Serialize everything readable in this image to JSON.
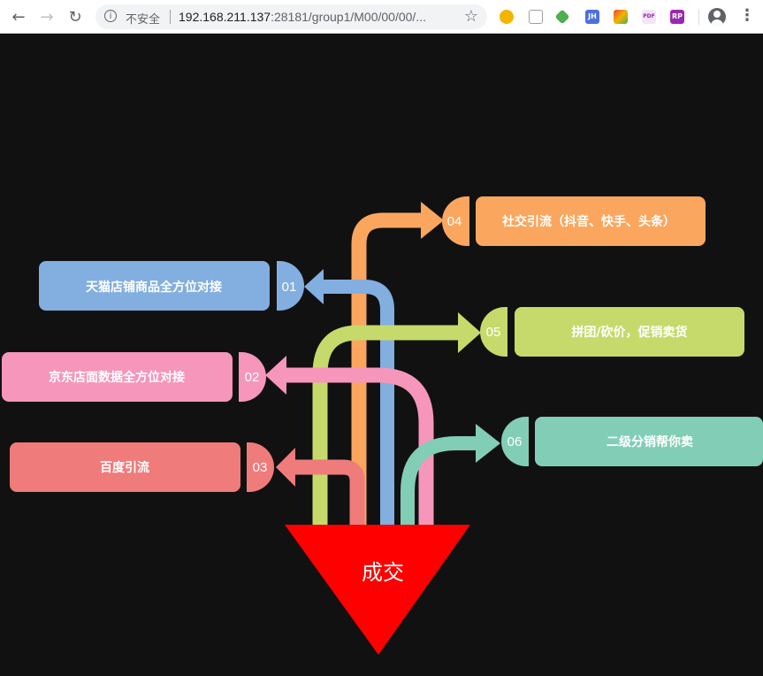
{
  "browser": {
    "back_icon": "arrow-left-icon",
    "forward_icon": "arrow-right-icon",
    "reload_icon": "reload-icon",
    "security_label": "不安全",
    "url_host": "192.168.211.137",
    "url_rest": ":28181/group1/M00/00/00/...",
    "bookmark_icon": "star-icon",
    "extensions": [
      {
        "icon": "extension-fire-icon",
        "color": "#f5b400",
        "label": ""
      },
      {
        "icon": "extension-search-icon",
        "color": "#ffffff",
        "label": ""
      },
      {
        "icon": "extension-chrome-icon",
        "color": "#4caf50",
        "label": ""
      },
      {
        "icon": "extension-jh-icon",
        "color": "#4f6fe0",
        "label": "JH"
      },
      {
        "icon": "extension-colorful-icon",
        "color": "#e8453c",
        "label": ""
      },
      {
        "icon": "extension-pdf-icon",
        "color": "#f3e5f5",
        "label": "PDF"
      },
      {
        "icon": "extension-rp-icon",
        "color": "#9c27b0",
        "label": "RP"
      }
    ]
  },
  "diagram": {
    "center_label": "成交",
    "center_color": "#ff0000",
    "items": [
      {
        "number": "01",
        "text": "天猫店铺商品全方位对接",
        "color": "#82aee0"
      },
      {
        "number": "02",
        "text": "京东店面数据全方位对接",
        "color": "#f596ba"
      },
      {
        "number": "03",
        "text": "百度引流",
        "color": "#ef7b7b"
      },
      {
        "number": "04",
        "text": "社交引流（抖音、快手、头条）",
        "color": "#fba65e"
      },
      {
        "number": "05",
        "text": "拼团/砍价，促销卖货",
        "color": "#c5da6a"
      },
      {
        "number": "06",
        "text": "二级分销帮你卖",
        "color": "#82cdb5"
      }
    ]
  }
}
